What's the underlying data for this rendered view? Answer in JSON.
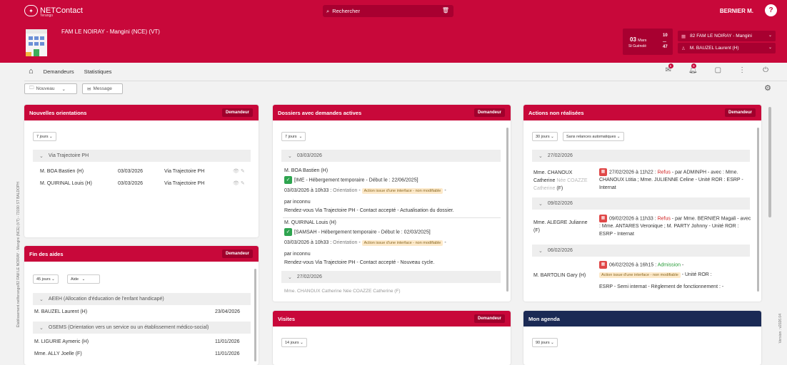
{
  "topbar": {
    "brand": "NETContact",
    "brand_sub": "Terango",
    "search_placeholder": "Rechercher",
    "user": "BERNIER M.",
    "help": "?"
  },
  "header": {
    "title": "FAM LE NOIRAY - Mangini (NCE) (VT)",
    "date": "03",
    "month": "Mars",
    "saint": "St Guénolé",
    "num_top": "10",
    "num_bottom": "47",
    "establishment": "82 FAM LE NOIRAY - Mangini",
    "person": "M. BAUZEL Laurent (H)"
  },
  "nav": {
    "items": [
      "Demandeurs",
      "Statistiques"
    ],
    "badge1": "5",
    "badge2": "8"
  },
  "toolbar": {
    "nouveau": "Nouveau",
    "message": "Message"
  },
  "orientations": {
    "title": "Nouvelles orientations",
    "button": "Demandeur",
    "filter": "7 jours",
    "group": "Via Trajectoire PH",
    "rows": [
      {
        "name": "M. BOA Bastien (H)",
        "date": "03/03/2026",
        "source": "Via Trajectoire PH"
      },
      {
        "name": "M. QUIRINAL Louis (H)",
        "date": "03/03/2026",
        "source": "Via Trajectoire PH"
      }
    ]
  },
  "aides": {
    "title": "Fin des aides",
    "button": "Demandeur",
    "filter1": "45 jours",
    "filter2": "Aide",
    "group1": "AEEH (Allocation d'éducation de l'enfant handicapé)",
    "group2": "OSEMS (Orientation vers un service ou un établissement médico-social)",
    "rows": [
      {
        "name": "M. BAUZEL Laurent (H)",
        "date": "23/04/2026"
      },
      {
        "name": "M. LIGURIE Aymeric (H)",
        "date": "11/01/2026"
      },
      {
        "name": "Mme. ALLY Joelle (F)",
        "date": "11/01/2026"
      }
    ]
  },
  "dossiers": {
    "title": "Dossiers avec demandes actives",
    "button": "Demandeur",
    "filter": "7 jours",
    "group1": "03/03/2026",
    "group2": "27/02/2026",
    "entries": [
      {
        "name": "M. BOA Bastien (H)",
        "service": "[IME - Hébergement temporaire - Début le : 22/06/2025]",
        "when": "03/03/2026 à 10h33 :",
        "kind": "Orientation",
        "tag": "Action issue d'une interface - non modifiable",
        "by": "par inconnu",
        "detail": "Rendez-vous Via Trajectoire PH - Contact accepté - Actualisation du dossier."
      },
      {
        "name": "M. QUIRINAL Louis (H)",
        "service": "[SAMSAH - Hébergement temporaire - Début le : 02/03/2025]",
        "when": "03/03/2026 à 10h33 :",
        "kind": "Orientation",
        "tag": "Action issue d'une interface - non modifiable",
        "by": "par inconnu",
        "detail": "Rendez-vous Via Trajectoire PH - Contact accepté - Nouveau cycle."
      }
    ],
    "cut_name": "Mme. CHANOUX Catherine Née COAZZE Catherine (F)"
  },
  "actions": {
    "title": "Actions non réalisées",
    "button": "Demandeur",
    "filter1": "30 jours",
    "filter2": "Sans relances automatiques",
    "groups": [
      "27/02/2026",
      "09/02/2026",
      "06/02/2026"
    ],
    "a1": {
      "name": "Mme. CHANOUX Catherine",
      "nee": "Née COAZZE Catherine",
      "sex": "(F)",
      "when": "27/02/2026 à 11h22 :",
      "status": "Refus",
      "by": "- par ADMINPH - avec :",
      "text": "Mme. CHANOUX Ltitia ; Mme. JULIENNE Celine - Unité ROR : ESRP - Internat"
    },
    "a2": {
      "name": "Mme. ALEGRE Julianne (F)",
      "when": "09/02/2026 à 11h33 :",
      "status": "Refus",
      "by": "- par Mme. BERNIER",
      "text": "Magali - avec : Mme. ANTARES Veronique ; M. PARTY Johnny - Unité ROR : ESRP - Internat"
    },
    "a3": {
      "name": "M. BARTOLIN Gary (H)",
      "when": "06/02/2026 à 16h15 :",
      "status": "Admission",
      "tag": "Action issue d'une interface - non modifiable",
      "after": "- Unité ROR :",
      "text": "ESRP - Semi internat - Règlement de fonctionnement : -"
    }
  },
  "visites": {
    "title": "Visites",
    "button": "Demandeur",
    "filter": "14 jours"
  },
  "agenda": {
    "title": "Mon agenda",
    "filter": "90 jours"
  },
  "side": {
    "left": "Établissement.net/terango/82 FAM LE NOIRAY - Mangini (NCE) (VT) - 73190 ST BALDOPH",
    "right": "Version : v2026.04"
  },
  "colors": {
    "brand": "#c8083a",
    "navy": "#1b2a55"
  }
}
